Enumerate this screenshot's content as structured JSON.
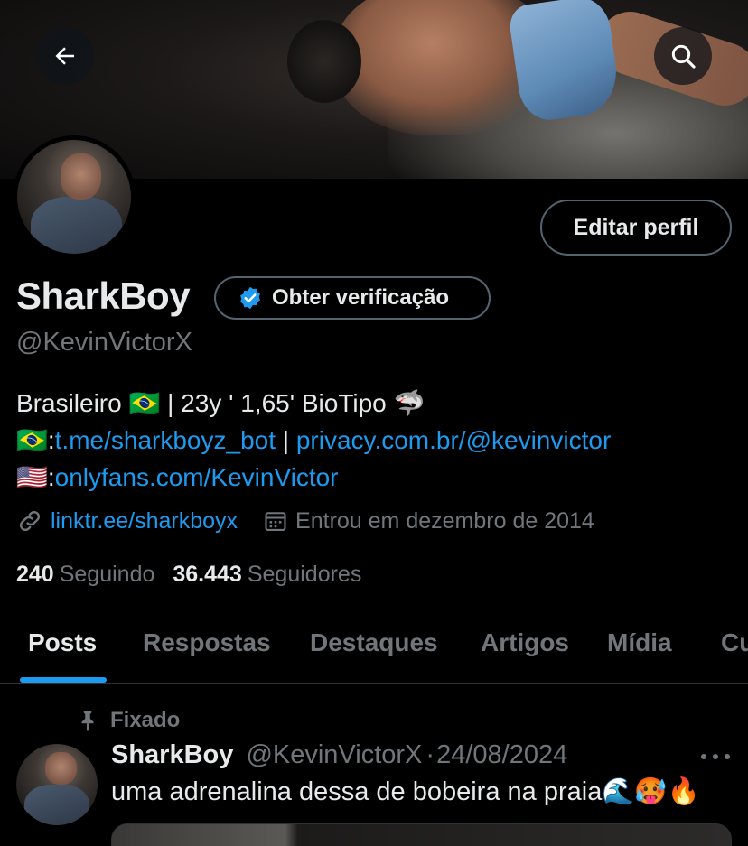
{
  "header": {
    "back_icon": "arrow-left-icon",
    "search_icon": "search-icon"
  },
  "profile": {
    "name": "SharkBoy",
    "handle": "@KevinVictorX",
    "edit_button": "Editar perfil",
    "verify_button": "Obter verificação",
    "bio": {
      "line1_text": "Brasileiro 🇧🇷 | 23y ' 1,65' BioTipo 🦈",
      "line2_flag": "🇧🇷:",
      "line2_link1": "t.me/sharkboyz_bot",
      "line2_sep": " | ",
      "line2_link2": "privacy.com.br/@kevinvictor",
      "line3_flag": "🇺🇸:",
      "line3_link": "onlyfans.com/KevinVictor"
    },
    "website": "linktr.ee/sharkboyx",
    "joined": "Entrou em dezembro de 2014",
    "following_count": "240",
    "following_label": "Seguindo",
    "followers_count": "36.443",
    "followers_label": "Seguidores"
  },
  "tabs": [
    {
      "label": "Posts"
    },
    {
      "label": "Respostas"
    },
    {
      "label": "Destaques"
    },
    {
      "label": "Artigos"
    },
    {
      "label": "Mídia"
    },
    {
      "label": "Cu"
    }
  ],
  "pinned_post": {
    "pinned_label": "Fixado",
    "author_name": "SharkBoy",
    "author_handle": "@KevinVictorX",
    "separator": "·",
    "date": "24/08/2024",
    "text": "uma adrenalina dessa de bobeira na praia🌊🥵🔥"
  },
  "colors": {
    "background": "#000000",
    "accent": "#1d9bf0",
    "secondary_text": "#71767b",
    "border": "#536471"
  }
}
